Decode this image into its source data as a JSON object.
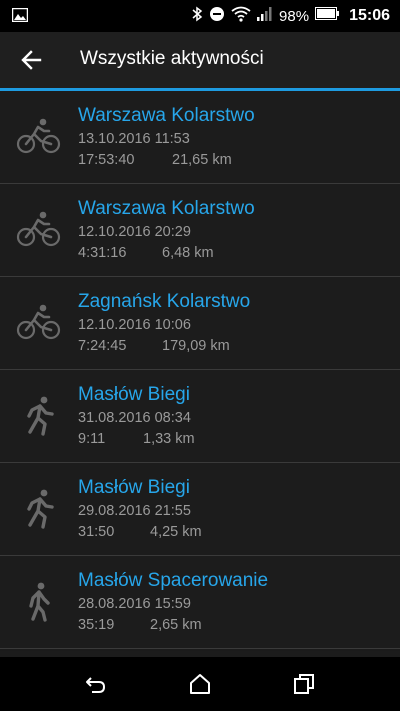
{
  "status": {
    "battery": "98%",
    "time": "15:06"
  },
  "appbar": {
    "title": "Wszystkie aktywności"
  },
  "activities": [
    {
      "icon": "bike-icon",
      "name": "Warszawa Kolarstwo",
      "date": "13.10.2016 11:53",
      "duration": "17:53:40",
      "distance": "21,65 km"
    },
    {
      "icon": "bike-icon",
      "name": "Warszawa Kolarstwo",
      "date": "12.10.2016 20:29",
      "duration": "4:31:16",
      "distance": "6,48 km"
    },
    {
      "icon": "bike-icon",
      "name": "Zagnańsk Kolarstwo",
      "date": "12.10.2016 10:06",
      "duration": "7:24:45",
      "distance": "179,09 km"
    },
    {
      "icon": "running-icon",
      "name": "Masłów Biegi",
      "date": "31.08.2016 08:34",
      "duration": "9:11",
      "distance": "1,33 km"
    },
    {
      "icon": "running-icon",
      "name": "Masłów Biegi",
      "date": "29.08.2016 21:55",
      "duration": "31:50",
      "distance": "4,25 km"
    },
    {
      "icon": "walking-icon",
      "name": "Masłów Spacerowanie",
      "date": "28.08.2016 15:59",
      "duration": "35:19",
      "distance": "2,65 km"
    }
  ],
  "colors": {
    "accent": "#1e9be0",
    "title_blue": "#27a6ea",
    "meta_gray": "#9a9a9a"
  }
}
